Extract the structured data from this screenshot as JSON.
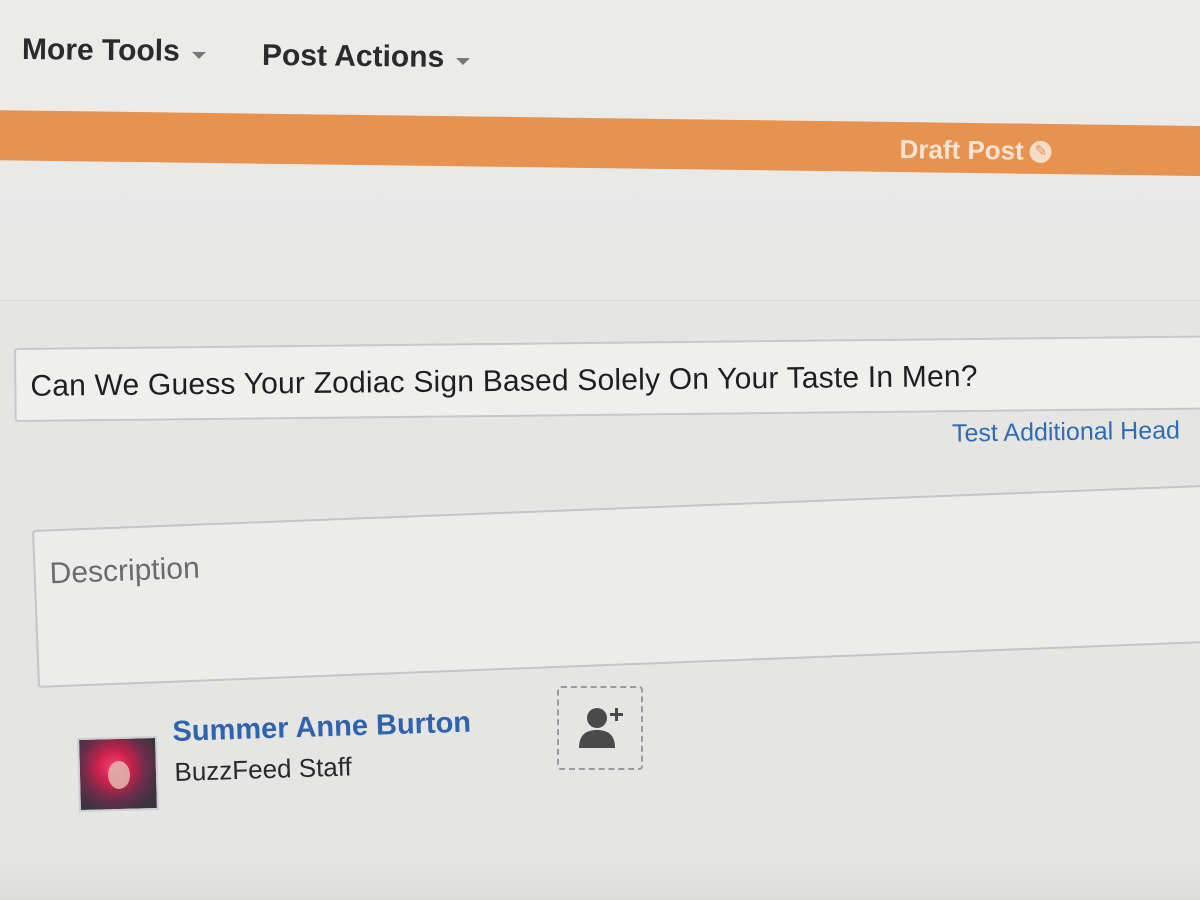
{
  "toolbar": {
    "more_tools_label": "More Tools",
    "post_actions_label": "Post Actions"
  },
  "status": {
    "label": "Draft Post",
    "color": "#e8924f"
  },
  "post": {
    "title_value": "Can We Guess Your Zodiac Sign Based Solely On Your Taste In Men?",
    "test_headline_link": "Test Additional Head",
    "description_placeholder": "Description"
  },
  "author": {
    "name": "Summer Anne Burton",
    "role": "BuzzFeed Staff"
  },
  "icons": {
    "caret": "chevron-down-icon",
    "draft": "pencil-icon",
    "add_author": "add-user-icon"
  }
}
